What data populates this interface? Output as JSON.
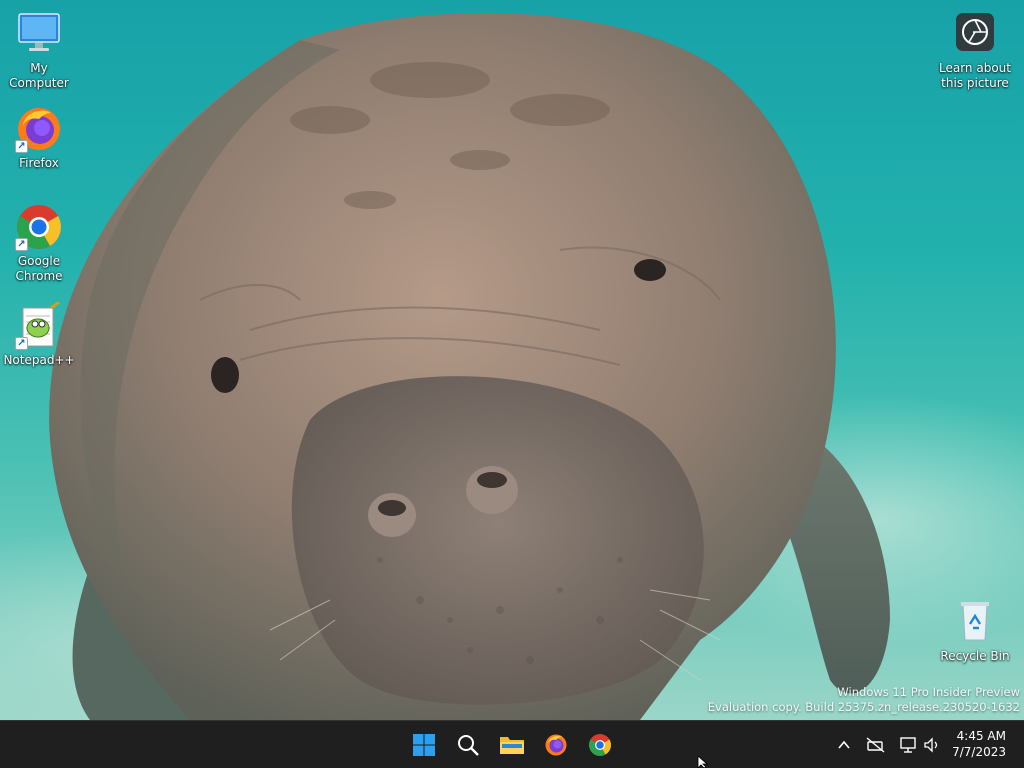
{
  "desktop": {
    "icons": [
      {
        "label": "My Computer",
        "icon": "monitor-icon"
      },
      {
        "label": "Firefox",
        "icon": "firefox-icon"
      },
      {
        "label": "Google\nChrome",
        "icon": "chrome-icon"
      },
      {
        "label": "Notepad++",
        "icon": "notepad-plus-plus-icon"
      },
      {
        "label": "Learn about\nthis picture",
        "icon": "camera-spotlight-icon"
      },
      {
        "label": "Recycle Bin",
        "icon": "recycle-bin-icon"
      }
    ],
    "watermark": {
      "line1": "Windows 11 Pro Insider Preview",
      "line2": "Evaluation copy. Build 25375.zn_release.230520-1632"
    }
  },
  "taskbar": {
    "pinned": [
      {
        "name": "Start",
        "icon": "windows-start-icon"
      },
      {
        "name": "Search",
        "icon": "search-icon"
      },
      {
        "name": "File Explorer",
        "icon": "folder-icon"
      },
      {
        "name": "Firefox",
        "icon": "firefox-icon"
      },
      {
        "name": "Google Chrome",
        "icon": "chrome-icon"
      }
    ],
    "tray": {
      "icons": [
        "chevron-up-icon",
        "network-disconnected-icon",
        "display-icon",
        "speaker-icon"
      ],
      "time": "4:45 AM",
      "date": "7/7/2023"
    }
  },
  "colors": {
    "taskbar": "#1f1f1f",
    "water": "#1fa9a6",
    "start_blue": "#2b9ff0"
  }
}
